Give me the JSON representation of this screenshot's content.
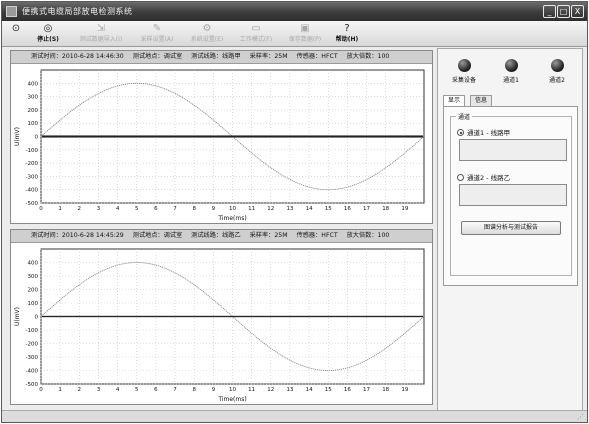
{
  "window": {
    "title": "便携式电缆局部放电检测系统",
    "controls": [
      "_",
      "□",
      "X"
    ]
  },
  "toolbar": {
    "buttons": [
      {
        "label": "",
        "icon": "sensor-icon",
        "enabled": true
      },
      {
        "label": "停止(S)",
        "icon": "stop-icon",
        "enabled": true
      },
      {
        "label": "测试数据导入(I)",
        "icon": "import-icon",
        "enabled": false
      },
      {
        "label": "采样设置(A)",
        "icon": "sampling-icon",
        "enabled": false
      },
      {
        "label": "系统设置(E)",
        "icon": "settings-icon",
        "enabled": false
      },
      {
        "label": "工作模式(F)",
        "icon": "mode-icon",
        "enabled": false
      },
      {
        "label": "保存数据(P)",
        "icon": "save-icon",
        "enabled": false
      },
      {
        "label": "帮助(H)",
        "icon": "help-icon",
        "enabled": true
      }
    ]
  },
  "charts": [
    {
      "header": {
        "test_time": "测试时间：2010-6-28  14:46:30",
        "location": "测试地点：调试室",
        "line": "测试线路：线路甲",
        "sample_rate": "采样率：25M",
        "sensor": "传感器：HFCT",
        "gain": "放大倍数：100"
      }
    },
    {
      "header": {
        "test_time": "测试时间：2010-6-28  14:45:29",
        "location": "测试地点：调试室",
        "line": "测试线路：线路乙",
        "sample_rate": "采样率：25M",
        "sensor": "传感器：HFCT",
        "gain": "放大倍数：100"
      }
    }
  ],
  "chart_data": [
    {
      "type": "line",
      "title": "",
      "xlabel": "Time(ms)",
      "ylabel": "U(mV)",
      "xlim": [
        0,
        20
      ],
      "ylim": [
        -500,
        500
      ],
      "x_ticks": [
        0,
        1,
        2,
        3,
        4,
        5,
        6,
        7,
        8,
        9,
        10,
        11,
        12,
        13,
        14,
        15,
        16,
        17,
        18,
        19
      ],
      "y_ticks": [
        400,
        300,
        200,
        100,
        0,
        -100,
        -200,
        -300,
        -400,
        -500
      ],
      "grid": true,
      "series": [
        {
          "kind": "reference_sine",
          "amplitude": 400,
          "period_ms": 20,
          "color": "#7a7a7a"
        },
        {
          "kind": "pd_signal_band",
          "baseline": 0,
          "band": [
            -8,
            8
          ],
          "color": "#222222"
        }
      ]
    },
    {
      "type": "line",
      "title": "",
      "xlabel": "Time(ms)",
      "ylabel": "U(mV)",
      "xlim": [
        0,
        20
      ],
      "ylim": [
        -500,
        500
      ],
      "x_ticks": [
        0,
        1,
        2,
        3,
        4,
        5,
        6,
        7,
        8,
        9,
        10,
        11,
        12,
        13,
        14,
        15,
        16,
        17,
        18,
        19
      ],
      "y_ticks": [
        400,
        300,
        200,
        100,
        0,
        -100,
        -200,
        -300,
        -400,
        -500
      ],
      "grid": true,
      "series": [
        {
          "kind": "reference_sine",
          "amplitude": 400,
          "period_ms": 20,
          "color": "#7a7a7a"
        },
        {
          "kind": "pd_signal_band",
          "baseline": 0,
          "band": [
            -5,
            5
          ],
          "color": "#222222"
        }
      ]
    }
  ],
  "side_panel": {
    "indicators": [
      {
        "label": "采集设备"
      },
      {
        "label": "通道1"
      },
      {
        "label": "通道2"
      }
    ],
    "tabs": [
      {
        "label": "显示",
        "active": true
      },
      {
        "label": "信息",
        "active": false
      }
    ],
    "group_title": "通道",
    "channels": [
      {
        "label": "通道1 - 线路甲",
        "selected": true
      },
      {
        "label": "通道2 - 线路乙",
        "selected": false
      }
    ],
    "report_button": "图谱分析与测试报告"
  }
}
